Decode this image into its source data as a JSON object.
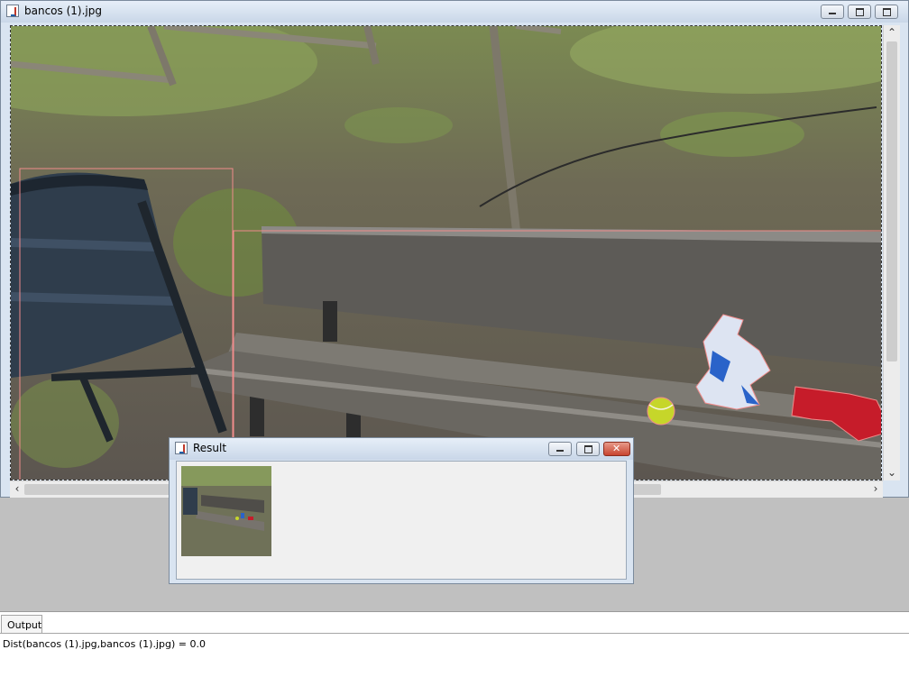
{
  "main_window": {
    "title": "bancos (1).jpg",
    "image_alt": "Photo of a wooden park bench beside a trash bin on a gravel slope, with a tennis ball, a plush bird toy and a red glove on the seat"
  },
  "result_window": {
    "title": "Result"
  },
  "output": {
    "tab_label": "Output",
    "log_line": "Dist(bancos (1).jpg,bancos (1).jpg) = 0.0"
  },
  "colors": {
    "title_gradient_top": "#e6eef8",
    "title_gradient_bottom": "#c9d7e8",
    "close_button": "#c8442f",
    "detection_box": "#f08c8c"
  },
  "icons": [
    "java-app-icon",
    "minimize-icon",
    "maximize-icon",
    "close-icon",
    "scroll-up-icon",
    "scroll-down-icon",
    "scroll-left-icon",
    "scroll-right-icon"
  ]
}
